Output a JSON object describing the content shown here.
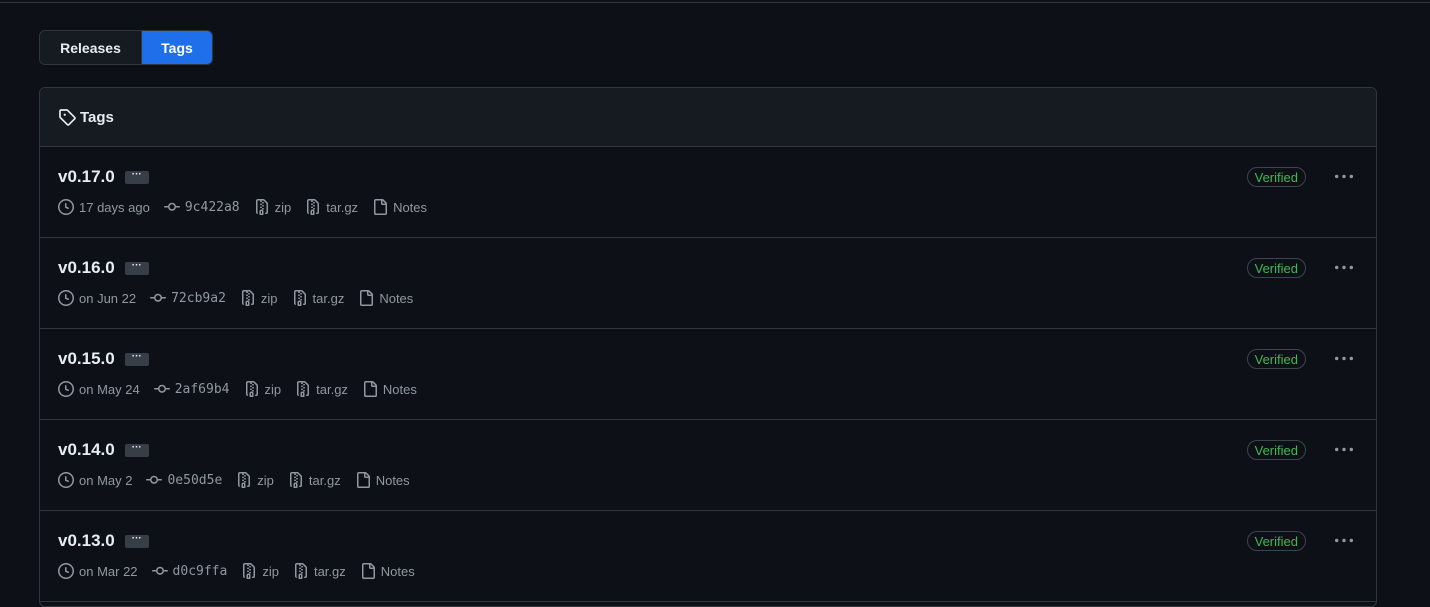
{
  "tabs": {
    "releases_label": "Releases",
    "tags_label": "Tags",
    "active": "Tags"
  },
  "box": {
    "title": "Tags"
  },
  "tags": [
    {
      "name": "v0.17.0",
      "date": "17 days ago",
      "sha": "9c422a8",
      "zip": "zip",
      "targz": "tar.gz",
      "notes": "Notes",
      "badge": "Verified"
    },
    {
      "name": "v0.16.0",
      "date": "on Jun 22",
      "sha": "72cb9a2",
      "zip": "zip",
      "targz": "tar.gz",
      "notes": "Notes",
      "badge": "Verified"
    },
    {
      "name": "v0.15.0",
      "date": "on May 24",
      "sha": "2af69b4",
      "zip": "zip",
      "targz": "tar.gz",
      "notes": "Notes",
      "badge": "Verified"
    },
    {
      "name": "v0.14.0",
      "date": "on May 2",
      "sha": "0e50d5e",
      "zip": "zip",
      "targz": "tar.gz",
      "notes": "Notes",
      "badge": "Verified"
    },
    {
      "name": "v0.13.0",
      "date": "on Mar 22",
      "sha": "d0c9ffa",
      "zip": "zip",
      "targz": "tar.gz",
      "notes": "Notes",
      "badge": "Verified"
    }
  ],
  "icons": {
    "tag": "tag-icon",
    "clock": "clock-icon",
    "commit": "commit-icon",
    "zip": "file-zip-icon",
    "notes": "file-icon",
    "kebab": "kebab-horizontal-icon"
  },
  "colors": {
    "background": "#0d1117",
    "accent": "#1f6feb",
    "verified": "#3fb950",
    "muted": "#9198a1"
  }
}
